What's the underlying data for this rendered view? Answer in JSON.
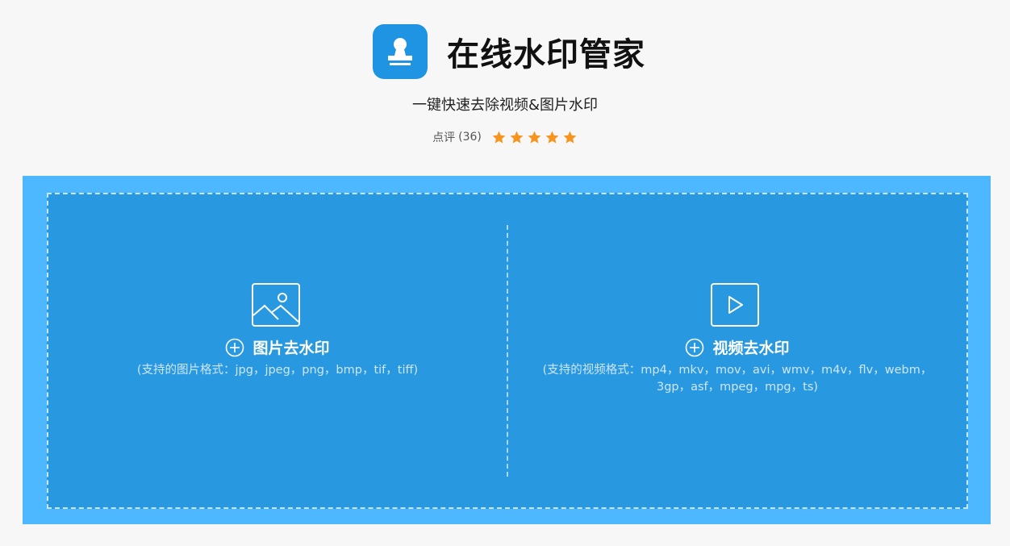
{
  "app": {
    "title": "在线水印管家",
    "subtitle": "一键快速去除视频&图片水印",
    "icon": "stamp-icon",
    "accent_color": "#1e94e2"
  },
  "rating": {
    "label": "点评",
    "count": "(36)",
    "stars": 5,
    "star_color": "#f7941d"
  },
  "upload": {
    "outer_color": "#4db8ff",
    "inner_color": "#2899e0",
    "image": {
      "icon": "image-icon",
      "action_label": "图片去水印",
      "formats": "(支持的图片格式：jpg，jpeg，png，bmp，tif，tiff)"
    },
    "video": {
      "icon": "video-play-icon",
      "action_label": "视频去水印",
      "formats": "(支持的视频格式：mp4，mkv，mov，avi，wmv，m4v，flv，webm，3gp，asf，mpeg，mpg，ts)"
    }
  }
}
